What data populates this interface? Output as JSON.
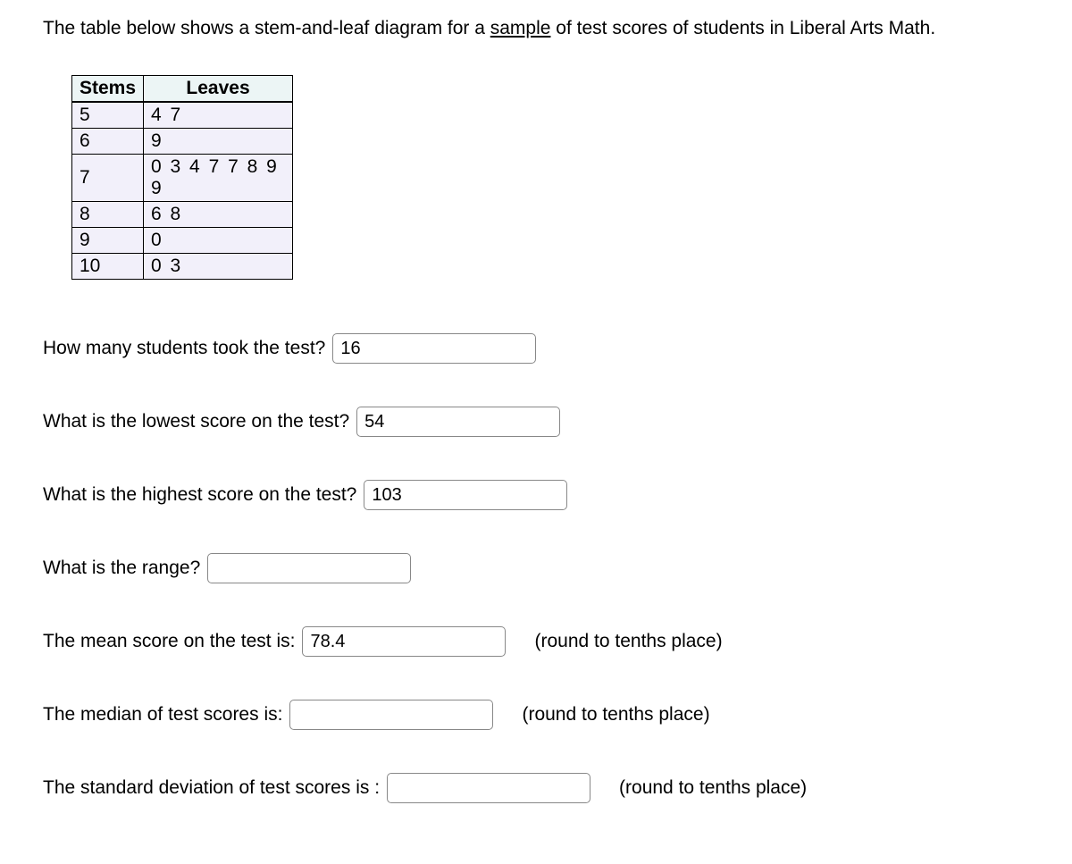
{
  "intro": {
    "prefix": "The table below shows a stem-and-leaf diagram for a ",
    "underlined": "sample",
    "suffix": " of test scores of students in Liberal Arts Math."
  },
  "table": {
    "header_stems": "Stems",
    "header_leaves": "Leaves",
    "rows": [
      {
        "stem": "5",
        "leaves": "4 7"
      },
      {
        "stem": "6",
        "leaves": "9"
      },
      {
        "stem": "7",
        "leaves": "0 3 4 7 7 8 9 9"
      },
      {
        "stem": "8",
        "leaves": "6 8"
      },
      {
        "stem": "9",
        "leaves": "0"
      },
      {
        "stem": "10",
        "leaves": "0 3"
      }
    ]
  },
  "questions": {
    "q1": {
      "label": "How many students took the test?",
      "value": "16"
    },
    "q2": {
      "label": "What is the lowest score on the test?",
      "value": "54"
    },
    "q3": {
      "label": "What is the highest score on the test?",
      "value": "103"
    },
    "q4": {
      "label": "What is the range?",
      "value": ""
    },
    "q5": {
      "label": "The mean score on the test is:",
      "value": "78.4",
      "hint": "(round to tenths place)"
    },
    "q6": {
      "label": "The median of test scores is:",
      "value": "",
      "hint": "(round to tenths place)"
    },
    "q7": {
      "label": "The standard deviation of test scores is :",
      "value": "",
      "hint": "(round to tenths place)"
    }
  }
}
